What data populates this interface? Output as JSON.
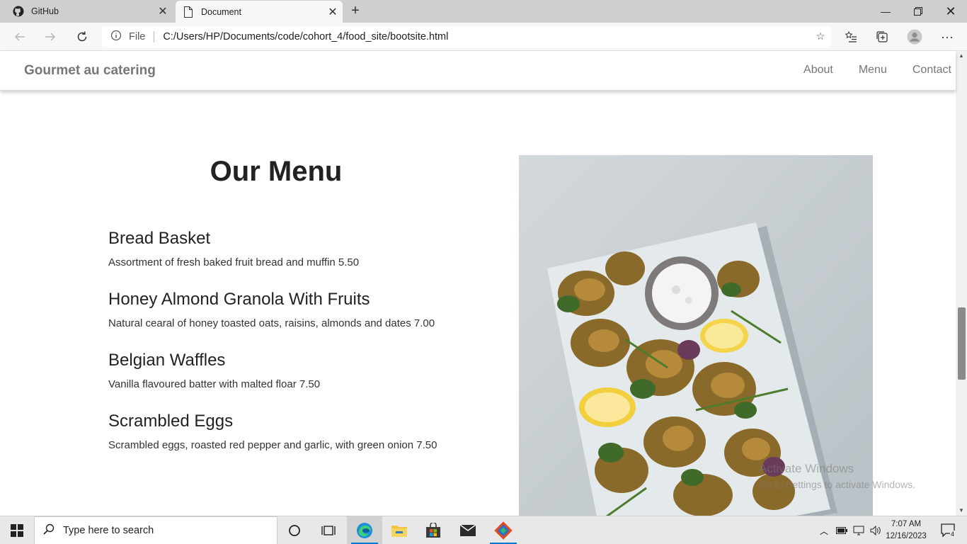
{
  "browser": {
    "tabs": [
      {
        "label": "GitHub",
        "icon": "github-icon",
        "active": false
      },
      {
        "label": "Document",
        "icon": "document-icon",
        "active": true
      }
    ],
    "address": {
      "scheme_label": "File",
      "url": "C:/Users/HP/Documents/code/cohort_4/food_site/bootsite.html"
    }
  },
  "site": {
    "brand": "Gourmet au catering",
    "nav": [
      "About",
      "Menu",
      "Contact"
    ]
  },
  "main": {
    "title": "Our Menu",
    "items": [
      {
        "name": "Bread Basket",
        "description": "Assortment of fresh baked fruit bread and muffin 5.50"
      },
      {
        "name": "Honey Almond Granola With Fruits",
        "description": "Natural cearal of honey toasted oats, raisins, almonds and dates 7.00"
      },
      {
        "name": "Belgian Waffles",
        "description": "Vanilla flavoured batter with malted floar 7.50"
      },
      {
        "name": "Scrambled Eggs",
        "description": "Scrambled eggs, roasted red pepper and garlic, with green onion 7.50"
      }
    ]
  },
  "watermark": {
    "line1": "Activate Windows",
    "line2": "Go to Settings to activate Windows."
  },
  "taskbar": {
    "search_placeholder": "Type here to search",
    "time": "7:07 AM",
    "date": "12/16/2023",
    "notification_count": "4"
  },
  "colors": {
    "nav_text": "#777777",
    "taskbar_bg": "#e8e8e8",
    "accent": "#0078d4"
  }
}
